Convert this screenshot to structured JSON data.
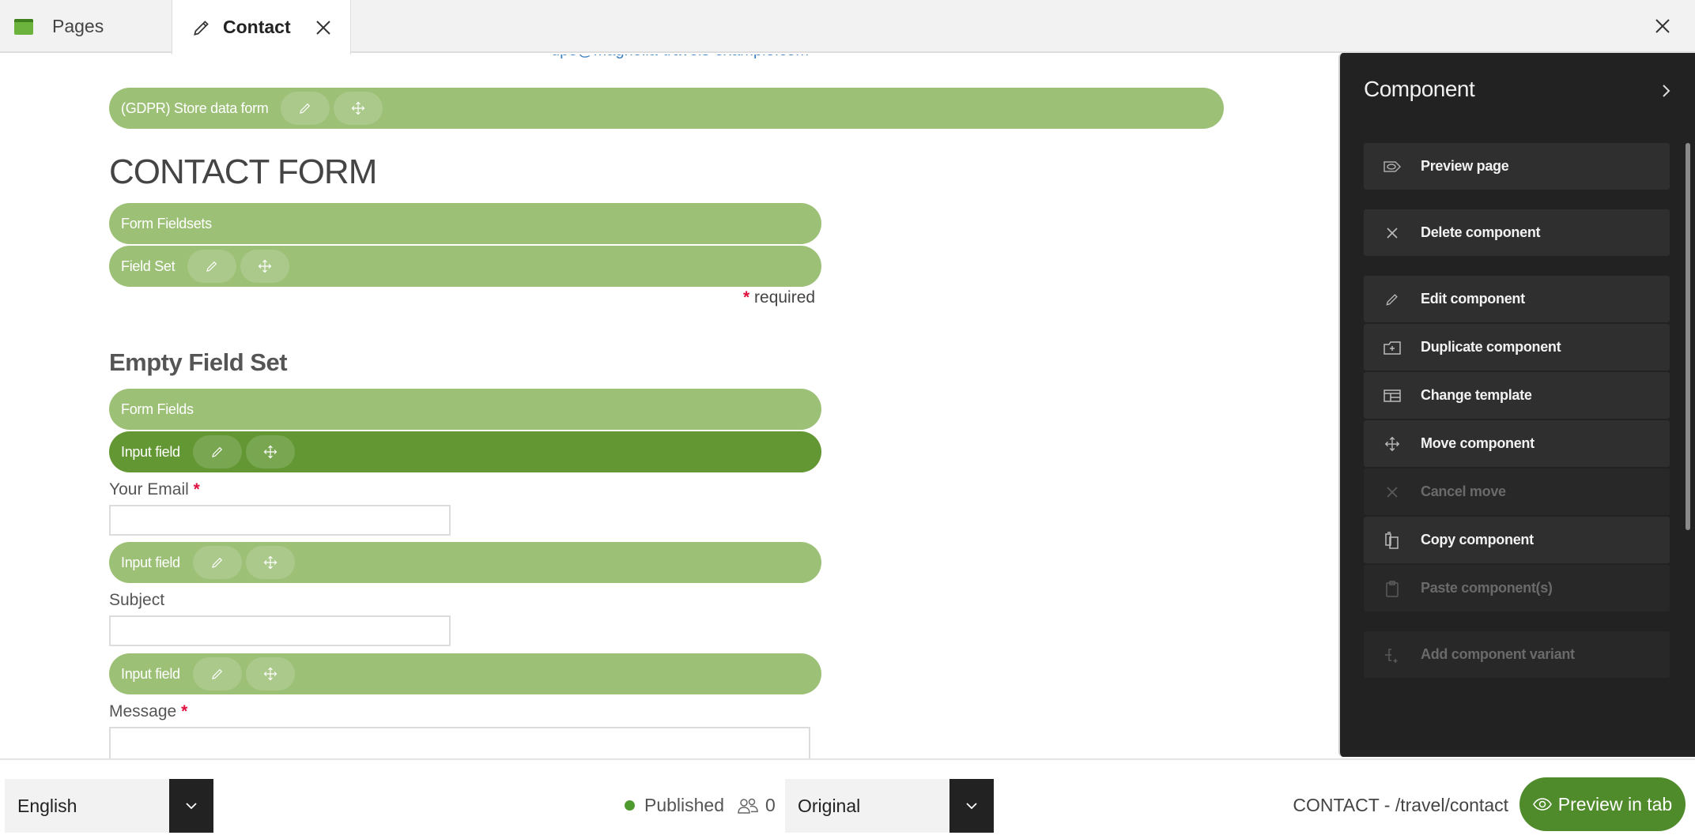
{
  "tabs": [
    {
      "label": "Pages",
      "icon": "pages-icon",
      "active": false
    },
    {
      "label": "Contact",
      "icon": "pencil-icon",
      "active": true,
      "closable": true
    }
  ],
  "window": {
    "close_icon": "close-icon"
  },
  "canvas": {
    "email_cut": "dpo@magnolia-travels-example.com",
    "gdpr_bar": {
      "label": "(GDPR) Store data form"
    },
    "heading": "CONTACT FORM",
    "fieldsets_bar": {
      "label": "Form Fieldsets"
    },
    "fieldset_bar": {
      "label": "Field Set"
    },
    "required_note": {
      "star": "*",
      "text": "required"
    },
    "empty_fieldset_heading": "Empty Field Set",
    "form_fields_bar": {
      "label": "Form Fields"
    },
    "fields": [
      {
        "bar_label": "Input field",
        "label": "Your Email",
        "required": true,
        "value": "",
        "active": true
      },
      {
        "bar_label": "Input field",
        "label": "Subject",
        "required": false,
        "value": "",
        "active": false
      },
      {
        "bar_label": "Input field",
        "label": "Message",
        "required": true,
        "value": "",
        "active": false
      }
    ],
    "bar_colors": {
      "normal": "#9dc077",
      "active": "#629733"
    }
  },
  "panel": {
    "title": "Component",
    "items": [
      {
        "label": "Preview page",
        "icon": "preview-page-icon",
        "enabled": true
      },
      {
        "label": "Delete component",
        "icon": "delete-icon",
        "enabled": true
      },
      {
        "label": "Edit component",
        "icon": "pencil-icon",
        "enabled": true
      },
      {
        "label": "Duplicate component",
        "icon": "duplicate-icon",
        "enabled": true
      },
      {
        "label": "Change template",
        "icon": "template-icon",
        "enabled": true
      },
      {
        "label": "Move component",
        "icon": "move-icon",
        "enabled": true
      },
      {
        "label": "Cancel move",
        "icon": "cancel-icon",
        "enabled": false
      },
      {
        "label": "Copy component",
        "icon": "copy-icon",
        "enabled": true
      },
      {
        "label": "Paste component(s)",
        "icon": "paste-icon",
        "enabled": false
      },
      {
        "label": "Add component variant",
        "icon": "add-variant-icon",
        "enabled": false
      }
    ]
  },
  "bottom": {
    "language": "English",
    "status": "Published",
    "status_color": "#4e9a2f",
    "users_count": "0",
    "version": "Original",
    "path": "CONTACT - /travel/contact",
    "preview_button": "Preview in tab",
    "accent": "#4f8a2b"
  }
}
